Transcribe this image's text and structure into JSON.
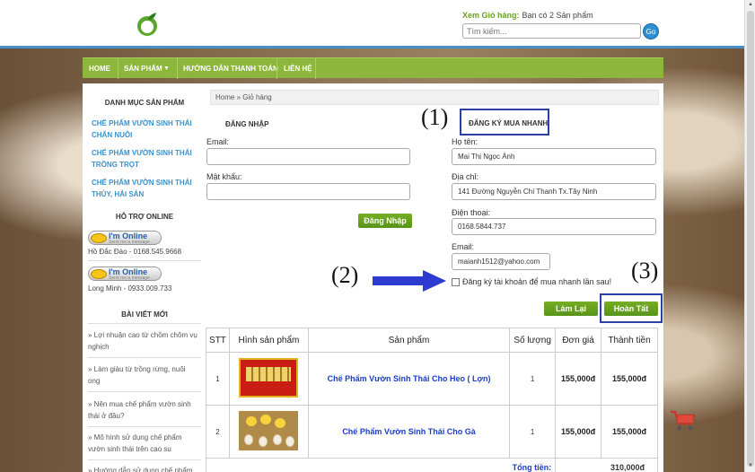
{
  "header": {
    "cart_link": "Xem Giỏ hàng:",
    "cart_status": "Bạn có 2 Sản phẩm",
    "search_placeholder": "Tìm kiếm...",
    "search_go": "Go"
  },
  "nav": {
    "items": [
      {
        "label": "HOME"
      },
      {
        "label": "SẢN PHẨM"
      },
      {
        "label": "HƯỚNG DẪN THANH TOÁN"
      },
      {
        "label": "LIÊN HỆ"
      }
    ]
  },
  "sidebar": {
    "categories_title": "DANH MỤC SẢN PHẨM",
    "categories": [
      {
        "line1": "CHẾ PHẨM VƯỜN SINH THÁI",
        "line2": "CHĂN NUÔI"
      },
      {
        "line1": "CHẾ PHẨM VƯỜN SINH THÁI",
        "line2": "TRỒNG TRỌT"
      },
      {
        "line1": "CHẾ PHẨM VƯỜN SINH THÁI",
        "line2": "THỦY, HẢI SẢN"
      }
    ],
    "support_title": "HỖ TRỢ ONLINE",
    "online_badge": "I'm Online",
    "online_sub": "Send me a message",
    "contacts": [
      {
        "text": "Hồ Đắc Đào - 0168.545.9668"
      },
      {
        "text": "Long Minh - 0933.009.733"
      }
    ],
    "posts_title": "BÀI VIẾT MỚI",
    "posts": [
      {
        "line1": "» Lợi nhuận cao từ chồm chôm vụ",
        "line2": "nghịch"
      },
      {
        "line1": "» Làm giàu từ trồng rừng, nuôi",
        "line2": "ong"
      },
      {
        "line1": "» Nên mua chế phẩm vườn sinh",
        "line2": "thái ở đâu?"
      },
      {
        "line1": "» Mô hình sử dụng chế phẩm",
        "line2": "vườn sinh thái trên cao su"
      },
      {
        "line1": "» Hướng dẫn sử dụng chế phẩm",
        "line2": ""
      }
    ]
  },
  "breadcrumb": {
    "home": "Home",
    "sep": "»",
    "current": "Giỏ hàng"
  },
  "login": {
    "title": "ĐĂNG NHẬP",
    "email_label": "Email:",
    "password_label": "Mật khẩu:",
    "submit": "Đăng Nhập"
  },
  "quick_register": {
    "title": "ĐĂNG KÝ MUA NHANH",
    "name_label": "Họ tên:",
    "name_value": "Mai Thị Ngọc Ánh",
    "address_label": "Địa chỉ:",
    "address_value": "141 Đường Nguyễn Chí Thanh Tx.Tây Ninh",
    "phone_label": "Điện thoại:",
    "phone_value": "0168.5844.737",
    "email_label": "Email:",
    "email_value": "maianh1512@yahoo.com",
    "checkbox_label": "Đăng ký tài khoản để mua nhanh lần sau!",
    "reset": "Làm Lại",
    "finish": "Hoàn Tất"
  },
  "annotations": {
    "a1": "(1)",
    "a2": "(2)",
    "a3": "(3)"
  },
  "cart_table": {
    "headers": [
      "STT",
      "Hình sản phẩm",
      "Sản phẩm",
      "Số lượng",
      "Đơn giá",
      "Thành tiền"
    ],
    "rows": [
      {
        "stt": "1",
        "name": "Chế Phẩm Vườn Sinh Thái Cho Heo ( Lợn)",
        "qty": "1",
        "price": "155,000đ",
        "total": "155,000đ"
      },
      {
        "stt": "2",
        "name": "Chế Phẩm Vườn Sinh Thái Cho Gà",
        "qty": "1",
        "price": "155,000đ",
        "total": "155,000đ"
      }
    ],
    "total_label": "Tổng tiền:",
    "total_value": "310,000đ"
  },
  "colors": {
    "accent_green": "#8cb63c",
    "button_green": "#65a11e",
    "link_blue": "#3c91c9",
    "annotation_box": "#2b3fa6"
  }
}
